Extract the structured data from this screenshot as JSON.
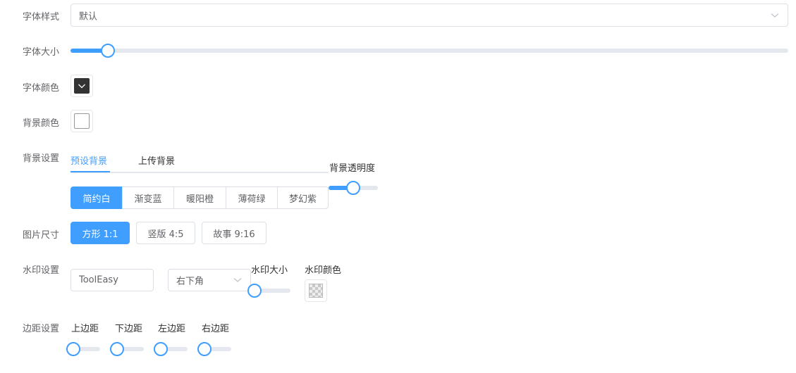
{
  "font_style": {
    "label": "字体样式",
    "value": "默认"
  },
  "font_size": {
    "label": "字体大小",
    "level": 0.03
  },
  "font_color": {
    "label": "字体颜色",
    "color": "#333333"
  },
  "bg_color": {
    "label": "背景颜色",
    "color": "#ffffff"
  },
  "bg_settings": {
    "label": "背景设置",
    "tabs": [
      {
        "label": "预设背景",
        "active": true
      },
      {
        "label": "上传背景",
        "active": false
      }
    ],
    "opacity_label": "背景透明度",
    "opacity_level": 0.5,
    "presets": [
      {
        "label": "简约白",
        "active": true
      },
      {
        "label": "渐变蓝",
        "active": false
      },
      {
        "label": "暖阳橙",
        "active": false
      },
      {
        "label": "薄荷绿",
        "active": false
      },
      {
        "label": "梦幻紫",
        "active": false
      }
    ]
  },
  "image_size": {
    "label": "图片尺寸",
    "options": [
      {
        "label": "方形 1:1",
        "active": true
      },
      {
        "label": "竖版 4:5",
        "active": false
      },
      {
        "label": "故事 9:16",
        "active": false
      }
    ]
  },
  "watermark": {
    "label": "水印设置",
    "text_value": "ToolEasy",
    "position_value": "右下角",
    "size_label": "水印大小",
    "size_level": 0.0,
    "color_label": "水印颜色"
  },
  "margins": {
    "label": "边距设置",
    "items": [
      {
        "label": "上边距",
        "level": 0.0
      },
      {
        "label": "下边距",
        "level": 0.0
      },
      {
        "label": "左边距",
        "level": 0.0
      },
      {
        "label": "右边距",
        "level": 0.0
      }
    ]
  },
  "colors": {
    "accent": "#409eff",
    "border": "#dcdfe6",
    "track": "#e4e7ed"
  }
}
